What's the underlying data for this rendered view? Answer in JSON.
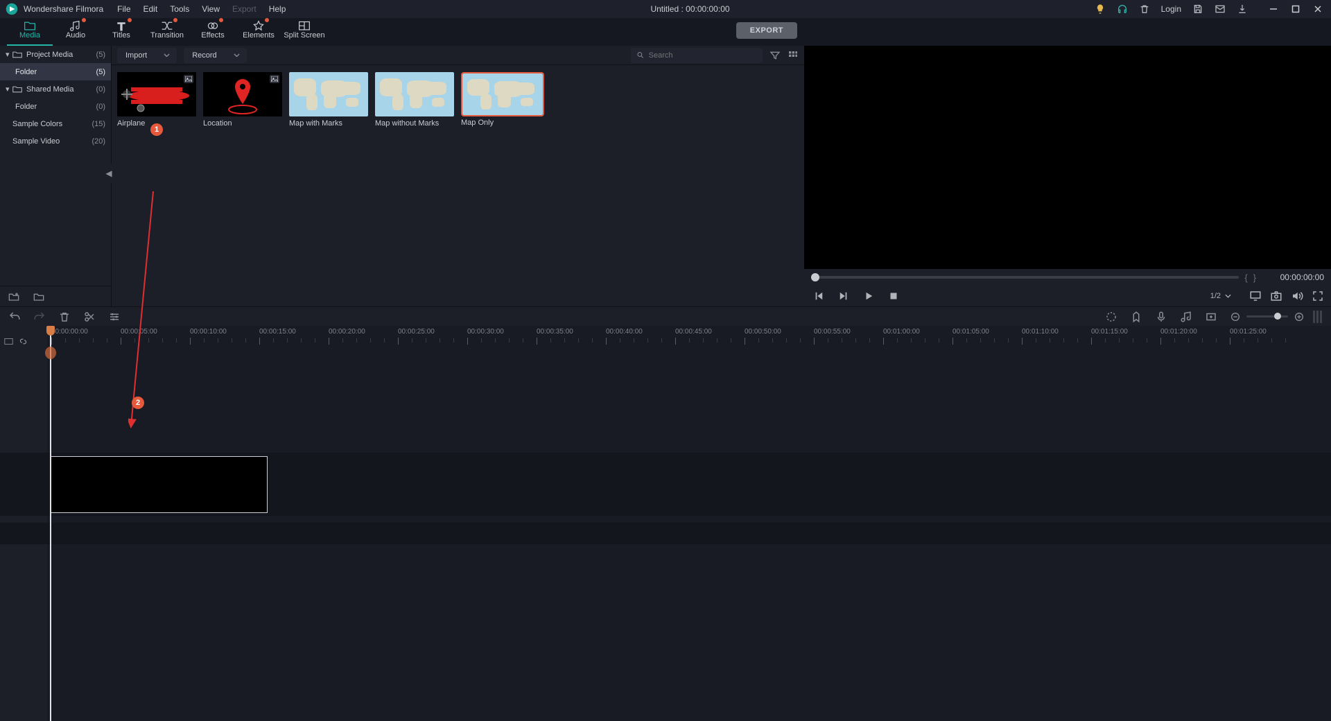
{
  "app": {
    "brand": "Wondershare Filmora",
    "title_center": "Untitled : 00:00:00:00"
  },
  "menu": {
    "file": "File",
    "edit": "Edit",
    "tools": "Tools",
    "view": "View",
    "export": "Export",
    "help": "Help"
  },
  "titlebar_right": {
    "login": "Login"
  },
  "ribbon": {
    "tabs": [
      {
        "label": "Media",
        "dot": false,
        "active": true
      },
      {
        "label": "Audio",
        "dot": true
      },
      {
        "label": "Titles",
        "dot": true
      },
      {
        "label": "Transition",
        "dot": true
      },
      {
        "label": "Effects",
        "dot": true
      },
      {
        "label": "Elements",
        "dot": true
      },
      {
        "label": "Split Screen",
        "dot": false
      }
    ],
    "export": "EXPORT"
  },
  "tree": {
    "items": [
      {
        "label": "Project Media",
        "count": "(5)",
        "indent": false,
        "folder": true,
        "disclosure": true
      },
      {
        "label": "Folder",
        "count": "(5)",
        "indent": true,
        "folder": false,
        "selected": true
      },
      {
        "label": "Shared Media",
        "count": "(0)",
        "indent": false,
        "folder": true,
        "disclosure": true
      },
      {
        "label": "Folder",
        "count": "(0)",
        "indent": true,
        "folder": false
      },
      {
        "label": "Sample Colors",
        "count": "(15)",
        "indent": false,
        "folder": false
      },
      {
        "label": "Sample Video",
        "count": "(20)",
        "indent": false,
        "folder": false
      }
    ]
  },
  "browser": {
    "import": "Import",
    "record": "Record",
    "search_placeholder": "Search",
    "thumbs": [
      {
        "label": "Airplane",
        "kind": "airplane",
        "corner": true
      },
      {
        "label": "Location",
        "kind": "pin",
        "corner": true
      },
      {
        "label": "Map with Marks",
        "kind": "map"
      },
      {
        "label": "Map without Marks",
        "kind": "map"
      },
      {
        "label": "Map Only",
        "kind": "map",
        "selected": true
      }
    ]
  },
  "annotations": {
    "badge1": "1",
    "badge2": "2"
  },
  "preview": {
    "timecode": "00:00:00:00",
    "scale": "1/2"
  },
  "timeline": {
    "ruler_start": "00:00:00:00",
    "interval_seconds": 5,
    "major_count": 18,
    "track_video": "1",
    "track_audio": "1"
  }
}
